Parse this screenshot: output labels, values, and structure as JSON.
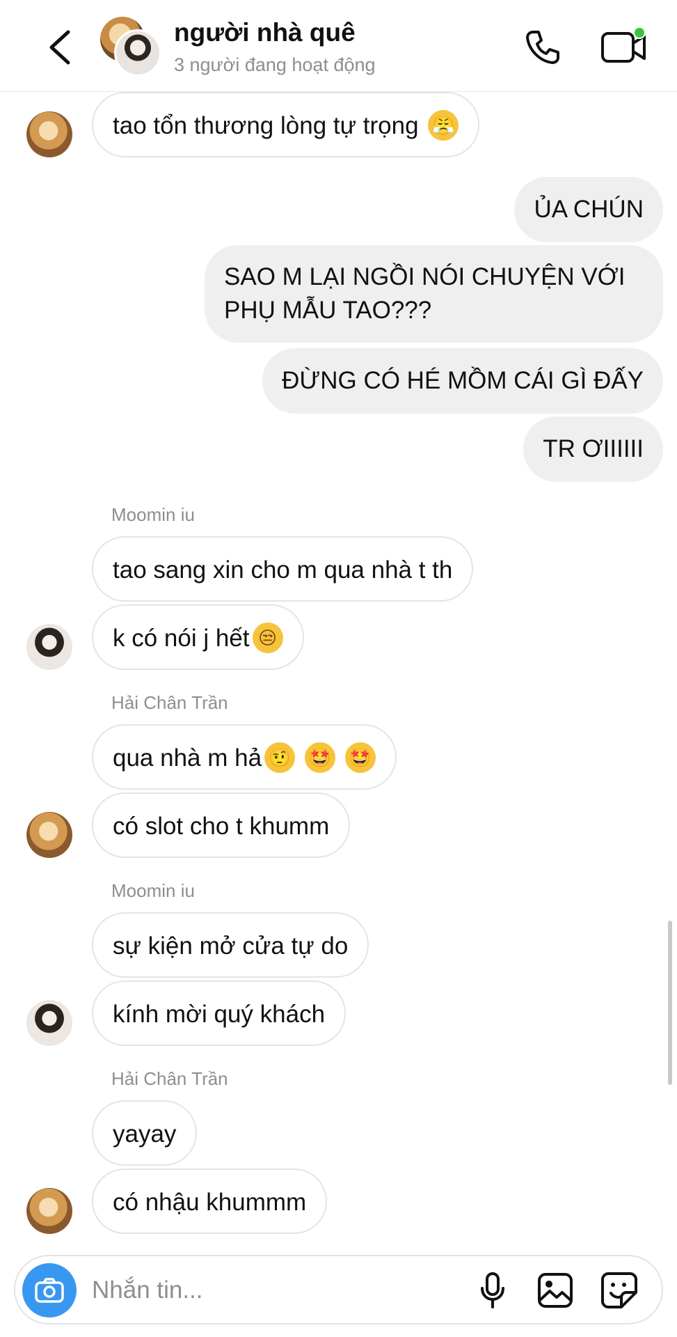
{
  "header": {
    "title": "người nhà quê",
    "subtitle": "3 người đang hoạt động"
  },
  "messages": {
    "m1": "tao tổn thương lòng tự trọng",
    "o1": "ỦA CHÚN",
    "o2": "SAO M LẠI NGỒI NÓI CHUYỆN VỚI PHỤ MẪU TAO???",
    "o3": "ĐỪNG CÓ HÉ MỒM CÁI GÌ ĐẤY",
    "o4": "TR ƠIIIIII",
    "sender1": "Moomin iu",
    "m2": "tao sang xin cho m qua nhà t th",
    "m3": "k có nói j hết",
    "sender2": "Hải Chân Trần",
    "m4": "qua nhà m hả",
    "m5": "có slot cho t khumm",
    "sender3": "Moomin iu",
    "m6": "sự kiện mở cửa tự do",
    "m7": "kính mời quý khách",
    "sender4": "Hải Chân Trần",
    "m8": "yayay",
    "m9": "có nhậu khummm"
  },
  "composer": {
    "placeholder": "Nhắn tin..."
  },
  "icons": {
    "back": "chevron-left-icon",
    "call": "phone-icon",
    "video": "video-camera-icon",
    "camera": "camera-icon",
    "mic": "microphone-icon",
    "gallery": "image-icon",
    "sticker": "sticker-icon"
  },
  "colors": {
    "accent": "#3897f0",
    "online": "#3cc43c",
    "outgoing_bubble": "#efefef"
  }
}
